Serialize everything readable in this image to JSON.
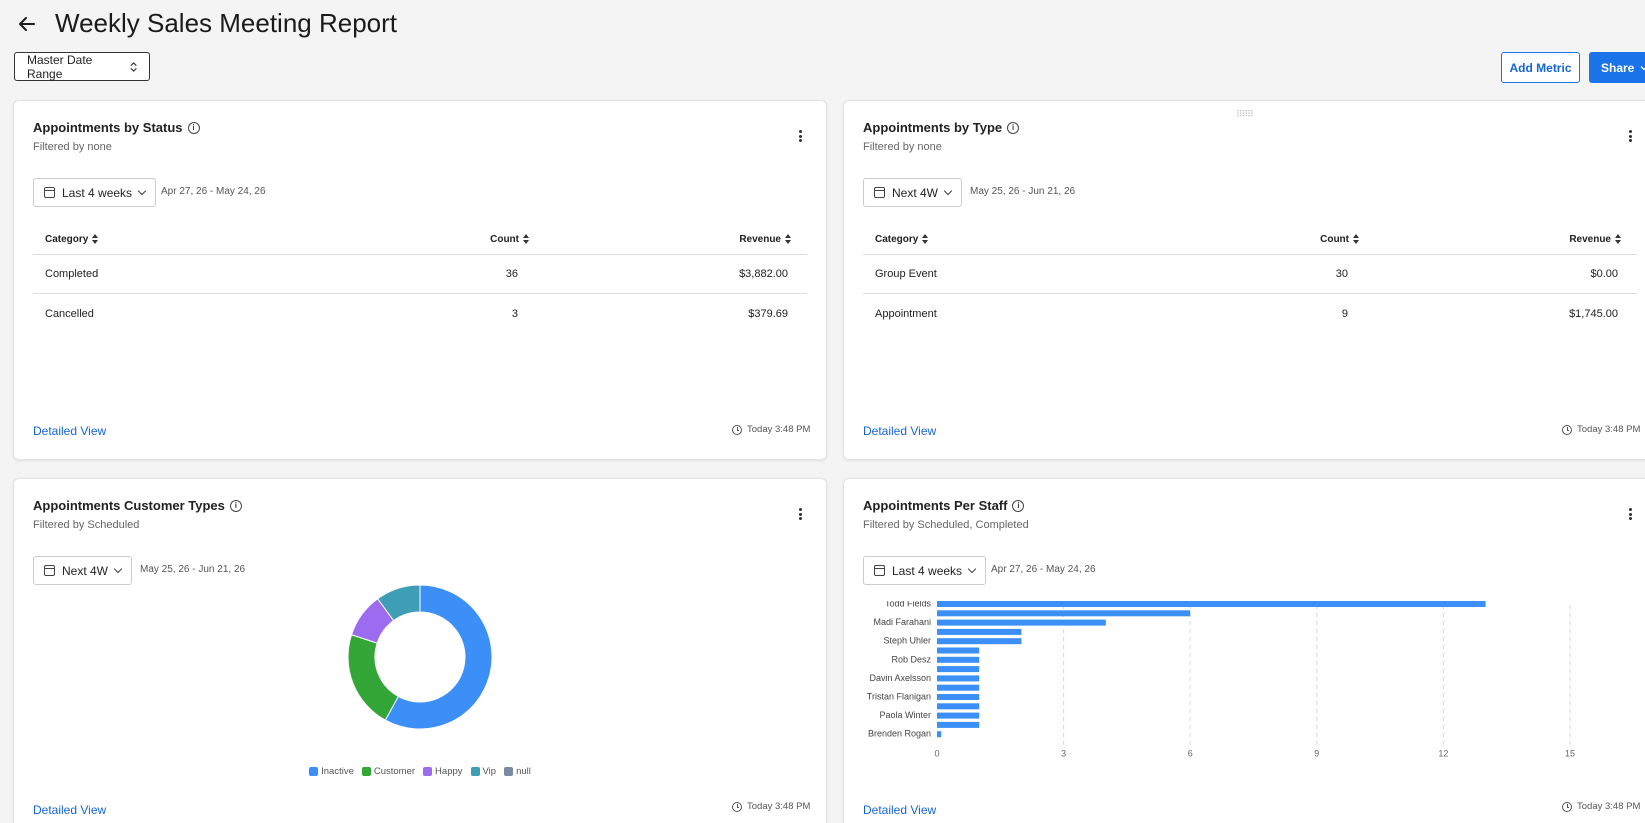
{
  "page": {
    "title": "Weekly Sales Meeting Report"
  },
  "toolbar": {
    "master_date_range": "Master Date Range",
    "add_metric": "Add Metric",
    "share": "Share"
  },
  "card1": {
    "title": "Appointments by Status",
    "subtitle": "Filtered by none",
    "period": "Last 4 weeks",
    "range": "Apr 27, 26 - May 24, 26",
    "columns": [
      "Category",
      "Count",
      "Revenue"
    ],
    "rows": [
      {
        "category": "Completed",
        "count": "36",
        "revenue": "$3,882.00"
      },
      {
        "category": "Cancelled",
        "count": "3",
        "revenue": "$379.69"
      }
    ],
    "detailed_view": "Detailed View",
    "updated": "Today 3:48 PM"
  },
  "card2": {
    "title": "Appointments by Type",
    "subtitle": "Filtered by none",
    "period": "Next 4W",
    "range": "May 25, 26 - Jun 21, 26",
    "columns": [
      "Category",
      "Count",
      "Revenue"
    ],
    "rows": [
      {
        "category": "Group Event",
        "count": "30",
        "revenue": "$0.00"
      },
      {
        "category": "Appointment",
        "count": "9",
        "revenue": "$1,745.00"
      }
    ],
    "detailed_view": "Detailed View",
    "updated": "Today 3:48 PM"
  },
  "card3": {
    "title": "Appointments Customer Types",
    "subtitle": "Filtered by Scheduled",
    "period": "Next 4W",
    "range": "May 25, 26 - Jun 21, 26",
    "detailed_view": "Detailed View",
    "updated": "Today 3:48 PM"
  },
  "card4": {
    "title": "Appointments Per Staff",
    "subtitle": "Filtered by Scheduled, Completed",
    "period": "Last 4 weeks",
    "range": "Apr 27, 26 - May 24, 26",
    "detailed_view": "Detailed View",
    "updated": "Today 3:48 PM"
  },
  "chart_data": [
    {
      "type": "pie",
      "donut": true,
      "categories": [
        "Inactive",
        "Customer",
        "Happy",
        "Vip",
        "null"
      ],
      "values": [
        58,
        22,
        10,
        10,
        0
      ],
      "colors": [
        "#3b8ff6",
        "#33a637",
        "#9b6cf0",
        "#3e9eb5",
        "#7b8aa3"
      ],
      "legend": "bottom"
    },
    {
      "type": "bar",
      "orientation": "horizontal",
      "categories": [
        "Todd Fields",
        "",
        "Madi Farahani",
        "",
        "Steph Uhler",
        "",
        "Rob Desz",
        "",
        "Davin Axelsson",
        "",
        "Tristan Flanigan",
        "",
        "Paola Winter",
        "",
        "Brenden Rogan"
      ],
      "values": [
        13,
        6,
        4,
        2,
        2,
        1,
        1,
        1,
        1,
        1,
        1,
        1,
        1,
        1,
        0.1
      ],
      "xlim": [
        0,
        15
      ],
      "xticks": [
        "0",
        "3",
        "6",
        "9",
        "12",
        "15"
      ],
      "color": "#3b8ff6",
      "grid": true
    }
  ],
  "colors": {
    "accent": "#1a73e8",
    "link": "#1565d8"
  }
}
